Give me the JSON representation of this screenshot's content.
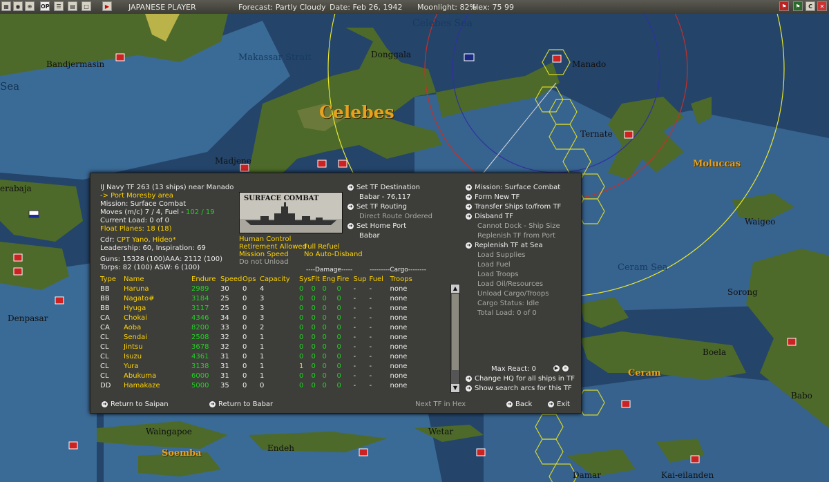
{
  "topbar": {
    "title": "JAPANESE PLAYER",
    "forecast": "Forecast: Partly Cloudy",
    "date": "Date: Feb 26, 1942",
    "moonlight": "Moonlight: 82%",
    "hex": "Hex: 75 99",
    "left_icons": [
      "map-icon",
      "globe-icon",
      "target-icon",
      "op-icon",
      "list-icon",
      "window-icon",
      "play-icon"
    ],
    "right_icons": [
      "flag-icon",
      "flag-icon",
      "c-icon",
      "close-icon"
    ],
    "op_label": "OP",
    "c_label": "C"
  },
  "map": {
    "labels": [
      "Bandjermasin",
      "Donggala",
      "Manado",
      "Celebes",
      "Ternate",
      "Madjene",
      "Moluccas",
      "Waigeo",
      "Sorong",
      "Denpasar",
      "Boela",
      "Ceram",
      "Babo",
      "Waingapoe",
      "Endeh",
      "Wetar",
      "Soemba",
      "Damar",
      "Kai-eilanden",
      "Sea",
      "erabaja",
      "Celebes Sea",
      "Makassar Strait",
      "Ceram Sea"
    ],
    "colors": {
      "sea": "#24446a",
      "shallow": "#3a6a96",
      "land": "#4d6a2a",
      "hex_outline": "#d8d829",
      "circle_yellow": "#e8e830",
      "circle_red": "#c83028",
      "circle_blue": "#3030a0"
    }
  },
  "panel": {
    "header": {
      "tf": "IJ Navy TF 263 (13 ships) near Manado",
      "destination": "-> Port Moresby area",
      "mission": "Mission: Surface Combat",
      "moves_prefix": "Moves (m/c) 7 / 4, Fuel - ",
      "fuel": "102 / 19",
      "load": "Current Load: 0 of 0",
      "float_planes": "Float Planes: 18 (18)",
      "cdr_prefix": "Cdr:",
      "cdr_name": "CPT Yano, Hideo*",
      "leadership": "Leadership: 60, Inspiration: 69",
      "guns": "Guns: 15328 (100)AAA: 2112 (100)",
      "torps": "Torps: 82 (100)    ASW: 6 (100)"
    },
    "image_caption": "SURFACE COMBAT",
    "orders": {
      "human_control": "Human Control",
      "retirement": "Retirement Allowed",
      "full_refuel": "Full Refuel",
      "mission_speed": "Mission Speed",
      "no_auto_disband": "No Auto-Disband",
      "do_not_unload": "Do not Unload"
    },
    "middle_menu": {
      "set_destination": "Set TF Destination",
      "babar_distance": "Babar - 76,117",
      "set_routing": "Set TF Routing",
      "direct_route": "Direct Route Ordered",
      "set_home": "Set Home Port",
      "home": "Babar"
    },
    "right_menu": [
      {
        "label": "Mission: Surface Combat",
        "enabled": true
      },
      {
        "label": "Form New TF",
        "enabled": true
      },
      {
        "label": "Transfer Ships to/from TF",
        "enabled": true
      },
      {
        "label": "Disband TF",
        "enabled": true
      },
      {
        "label": "Cannot Dock - Ship Size",
        "enabled": false
      },
      {
        "label": "Replenish TF from Port",
        "enabled": false
      },
      {
        "label": "Replenish TF at Sea",
        "enabled": true
      },
      {
        "label": "Load Supplies",
        "enabled": false
      },
      {
        "label": "Load Fuel",
        "enabled": false
      },
      {
        "label": "Load Troops",
        "enabled": false
      },
      {
        "label": "Load Oil/Resources",
        "enabled": false
      },
      {
        "label": "Unload Cargo/Troops",
        "enabled": false
      },
      {
        "label": "Cargo Status: Idle",
        "enabled": false
      },
      {
        "label": "Total Load: 0 of 0",
        "enabled": false
      }
    ],
    "group_headers": {
      "damage": "----Damage-----",
      "cargo": "---------Cargo--------"
    },
    "columns": [
      "Type",
      "Name",
      "Endure",
      "Speed",
      "Ops",
      "Capacity",
      "Sys",
      "Flt",
      "Eng",
      "Fire",
      "Sup",
      "Fuel",
      "Troops"
    ],
    "ships": [
      [
        "BB",
        "Haruna",
        "2989",
        "30",
        "0",
        "4",
        "0",
        "0",
        "0",
        "0",
        "-",
        "-",
        "none"
      ],
      [
        "BB",
        "Nagato#",
        "3184",
        "25",
        "0",
        "3",
        "0",
        "0",
        "0",
        "0",
        "-",
        "-",
        "none"
      ],
      [
        "BB",
        "Hyuga",
        "3117",
        "25",
        "0",
        "3",
        "0",
        "0",
        "0",
        "0",
        "-",
        "-",
        "none"
      ],
      [
        "CA",
        "Chokai",
        "4346",
        "34",
        "0",
        "3",
        "0",
        "0",
        "0",
        "0",
        "-",
        "-",
        "none"
      ],
      [
        "CA",
        "Aoba",
        "8200",
        "33",
        "0",
        "2",
        "0",
        "0",
        "0",
        "0",
        "-",
        "-",
        "none"
      ],
      [
        "CL",
        "Sendai",
        "2508",
        "32",
        "0",
        "1",
        "0",
        "0",
        "0",
        "0",
        "-",
        "-",
        "none"
      ],
      [
        "CL",
        "Jintsu",
        "3678",
        "32",
        "0",
        "1",
        "0",
        "0",
        "0",
        "0",
        "-",
        "-",
        "none"
      ],
      [
        "CL",
        "Isuzu",
        "4361",
        "31",
        "0",
        "1",
        "0",
        "0",
        "0",
        "0",
        "-",
        "-",
        "none"
      ],
      [
        "CL",
        "Yura",
        "3138",
        "31",
        "0",
        "1",
        "1",
        "0",
        "0",
        "0",
        "-",
        "-",
        "none"
      ],
      [
        "CL",
        "Abukuma",
        "6000",
        "31",
        "0",
        "1",
        "0",
        "0",
        "0",
        "0",
        "-",
        "-",
        "none"
      ],
      [
        "DD",
        "Hamakaze",
        "5000",
        "35",
        "0",
        "0",
        "0",
        "0",
        "0",
        "0",
        "-",
        "-",
        "none"
      ]
    ],
    "max_react": "Max React:  0",
    "change_hq": "Change HQ for all ships in TF",
    "show_arcs": "Show search arcs for this TF",
    "return_saipan": "Return to Saipan",
    "return_babar": "Return to Babar",
    "next_tf": "Next TF in Hex",
    "back": "Back",
    "exit": "Exit"
  }
}
